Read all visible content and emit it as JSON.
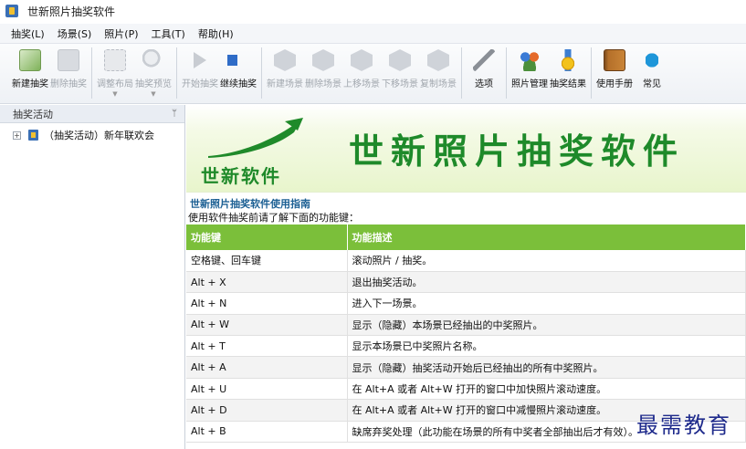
{
  "window": {
    "title": "世新照片抽奖软件"
  },
  "menu": [
    {
      "label": "抽奖(L)"
    },
    {
      "label": "场景(S)"
    },
    {
      "label": "照片(P)"
    },
    {
      "label": "工具(T)"
    },
    {
      "label": "帮助(H)"
    }
  ],
  "toolbar": {
    "buttons": [
      {
        "label": "新建抽奖",
        "icon": "new-lottery-icon",
        "enabled": true
      },
      {
        "label": "删除抽奖",
        "icon": "delete-lottery-icon",
        "enabled": false
      },
      {
        "label": "调整布局",
        "icon": "layout-icon",
        "enabled": false
      },
      {
        "label": "抽奖预览",
        "icon": "preview-icon",
        "enabled": false
      },
      {
        "label": "开始抽奖",
        "icon": "start-icon",
        "enabled": false
      },
      {
        "label": "继续抽奖",
        "icon": "continue-icon",
        "enabled": true
      },
      {
        "label": "新建场景",
        "icon": "new-scene-icon",
        "enabled": false
      },
      {
        "label": "删除场景",
        "icon": "delete-scene-icon",
        "enabled": false
      },
      {
        "label": "上移场景",
        "icon": "move-up-scene-icon",
        "enabled": false
      },
      {
        "label": "下移场景",
        "icon": "move-down-scene-icon",
        "enabled": false
      },
      {
        "label": "复制场景",
        "icon": "copy-scene-icon",
        "enabled": false
      },
      {
        "label": "选项",
        "icon": "options-icon",
        "enabled": true
      },
      {
        "label": "照片管理",
        "icon": "photo-manage-icon",
        "enabled": true
      },
      {
        "label": "抽奖结果",
        "icon": "result-icon",
        "enabled": true
      },
      {
        "label": "使用手册",
        "icon": "manual-icon",
        "enabled": true
      },
      {
        "label": "常见",
        "icon": "faq-icon",
        "enabled": true
      }
    ]
  },
  "sidebar": {
    "title": "抽奖活动",
    "pin_glyph": "ᛘ",
    "expander_glyph": "+",
    "items": [
      {
        "label": "（抽奖活动）新年联欢会"
      }
    ]
  },
  "banner": {
    "logo_text": "世新软件",
    "title": "世新照片抽奖软件",
    "accent_color": "#1e8a2a"
  },
  "guide": {
    "title": "世新照片抽奖软件使用指南",
    "intro": "使用软件抽奖前请了解下面的功能键：",
    "headers": [
      "功能键",
      "功能描述"
    ],
    "rows": [
      [
        "空格键、回车键",
        "滚动照片 / 抽奖。"
      ],
      [
        "Alt + X",
        "退出抽奖活动。"
      ],
      [
        "Alt + N",
        "进入下一场景。"
      ],
      [
        "Alt + W",
        "显示（隐藏）本场景已经抽出的中奖照片。"
      ],
      [
        "Alt + T",
        "显示本场景已中奖照片名称。"
      ],
      [
        "Alt + A",
        "显示（隐藏）抽奖活动开始后已经抽出的所有中奖照片。"
      ],
      [
        "Alt + U",
        "在 Alt+A 或者 Alt+W 打开的窗口中加快照片滚动速度。"
      ],
      [
        "Alt + D",
        "在 Alt+A 或者 Alt+W 打开的窗口中减慢照片滚动速度。"
      ],
      [
        "Alt + B",
        "缺席弃奖处理（此功能在场景的所有中奖者全部抽出后才有效）。"
      ]
    ],
    "header_color": "#7bbf3a"
  },
  "watermark": {
    "text": "最需教育"
  }
}
